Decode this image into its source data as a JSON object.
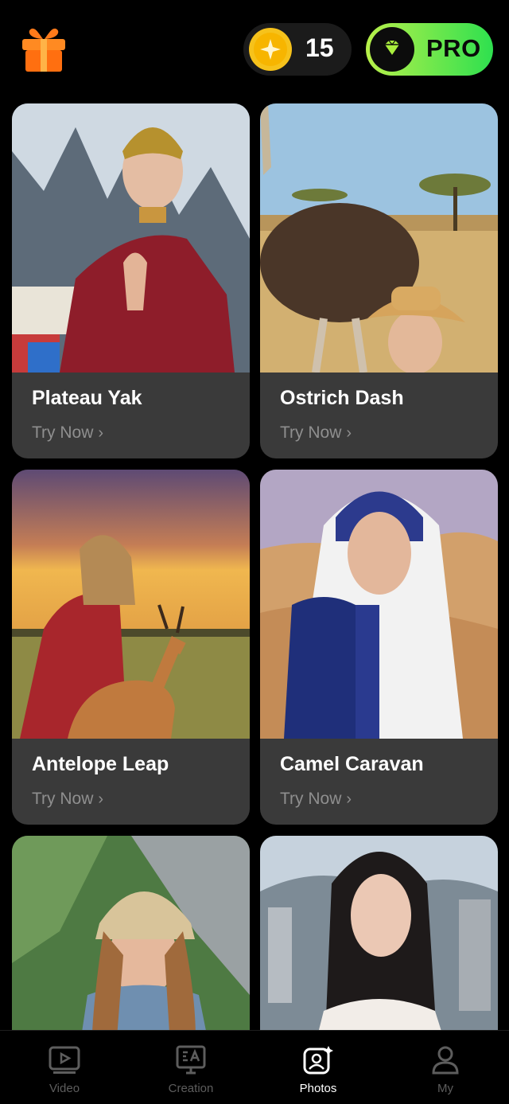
{
  "header": {
    "gift_icon": "gift-icon",
    "coins": {
      "icon": "coin-icon",
      "count": "15"
    },
    "pro": {
      "icon": "diamond-icon",
      "label": "PRO",
      "colors": [
        "#b8f04a",
        "#2ee04f"
      ]
    }
  },
  "cards": [
    {
      "title": "Plateau Yak",
      "cta": "Try Now",
      "chevron": "›"
    },
    {
      "title": "Ostrich Dash",
      "cta": "Try Now",
      "chevron": "›"
    },
    {
      "title": "Antelope Leap",
      "cta": "Try Now",
      "chevron": "›"
    },
    {
      "title": "Camel Caravan",
      "cta": "Try Now",
      "chevron": "›"
    }
  ],
  "nav": {
    "items": [
      {
        "label": "Video",
        "icon": "video-icon",
        "active": false
      },
      {
        "label": "Creation",
        "icon": "creation-icon",
        "active": false
      },
      {
        "label": "Photos",
        "icon": "photos-icon",
        "active": true
      },
      {
        "label": "My",
        "icon": "profile-icon",
        "active": false
      }
    ]
  },
  "colors": {
    "background": "#000000",
    "card": "#3a3a3a",
    "muted": "#8f8f8f",
    "coin": "#f5b800"
  }
}
